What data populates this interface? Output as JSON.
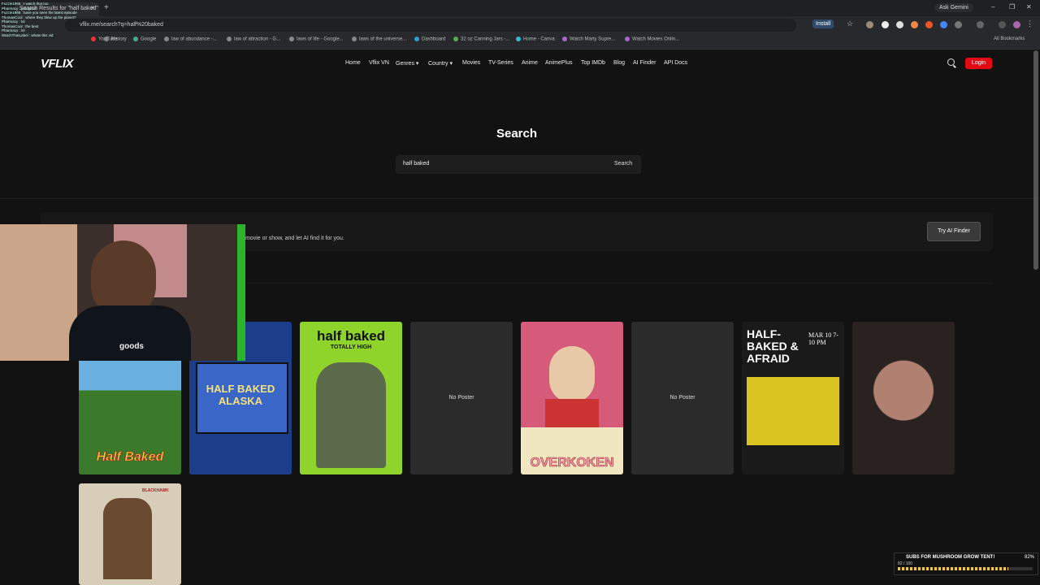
{
  "browser": {
    "tab_title": "Search Results for \"half baked\"",
    "ask_gemini": "Ask Gemini",
    "url": "vflix.me/search?q=half%20baked",
    "install_label": "Install",
    "bookmarks": [
      "History",
      "Google",
      "law of abundance -...",
      "law of attraction - G...",
      "laws of life - Google...",
      "laws of the universe...",
      "Dashboard",
      "32 oz Canning Jars -...",
      "Home - Canva",
      "Watch Marty Supre...",
      "Watch Movies Onlin..."
    ],
    "all_bookmarks": "All Bookmarks",
    "youtube": "YouTube"
  },
  "site": {
    "logo": "VFLIX",
    "nav": [
      "Home",
      "Vflix VN",
      "Genres ▾",
      "Country ▾",
      "Movies",
      "TV-Series",
      "Anime",
      "AnimePlus",
      "Top IMDb",
      "Blog",
      "AI Finder",
      "API Docs"
    ],
    "login_label": "Login",
    "heading": "Search",
    "search_value": "half baked",
    "search_button": "Search",
    "ai_text": "movie or show, and let AI find it for you.",
    "ai_button": "Try AI Finder",
    "no_poster": "No Poster"
  },
  "posters": [
    {
      "title": "Half Baked",
      "kind": "image",
      "bg": "#4a7a3a"
    },
    {
      "title": "HALF BAKED ALASKA",
      "kind": "image",
      "bg": "#1b3d8a"
    },
    {
      "title": "half baked",
      "subtitle": "TOTALLY HIGH",
      "kind": "image",
      "bg": "#8fd42a"
    },
    {
      "title": "No Poster",
      "kind": "none"
    },
    {
      "title": "OVERKOKEN",
      "kind": "image",
      "bg": "#d65a7a"
    },
    {
      "title": "No Poster",
      "kind": "none"
    },
    {
      "title": "HALF-BAKED & AFRAID",
      "subtitle": "MAR 10 7-10 PM",
      "kind": "image",
      "bg": "#1a1a1a"
    },
    {
      "title": "",
      "kind": "image",
      "bg": "#6a5a52"
    },
    {
      "title": "BLACKHAWK",
      "kind": "image",
      "bg": "#d8cdb8"
    }
  ],
  "stream": {
    "chat_lines": [
      "Fuzzie1995 : I watch that too",
      "Pharmacy : you good",
      "Fuzzie1995 : have you seen the latest episode",
      "ThomasCool : where they blew up the planet?",
      "Pharmacy : lol",
      "ThomasCool : the best",
      "Pharmacy : lol",
      "WatchThatLabel : whats this vid"
    ],
    "goal_title": "SUBS FOR MUSHROOM GROW TENT!",
    "goal_percent": "82%",
    "goal_count": "82 / 100",
    "goal_fraction": 0.82
  }
}
